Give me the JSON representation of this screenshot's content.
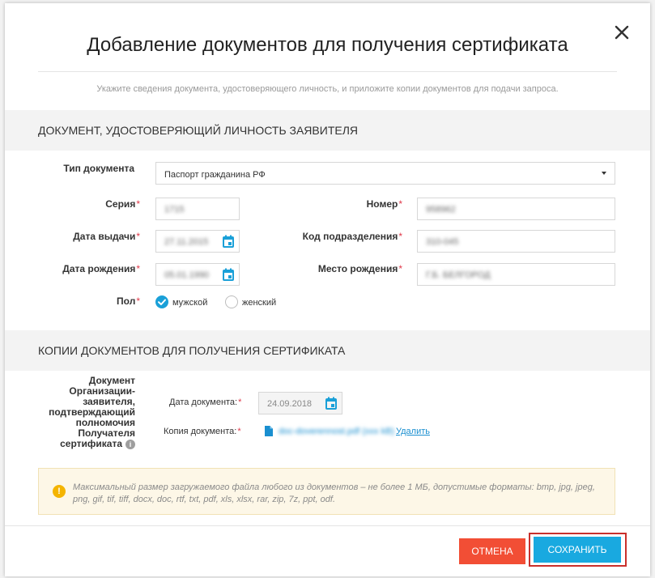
{
  "dialog": {
    "title": "Добавление документов для получения сертификата",
    "subtitle": "Укажите сведения документа, удостоверяющего личность, и приложите копии документов для подачи запроса."
  },
  "identity_section": {
    "heading": "ДОКУМЕНТ, УДОСТОВЕРЯЮЩИЙ ЛИЧНОСТЬ ЗАЯВИТЕЛЯ",
    "doc_type_label": "Тип документа",
    "doc_type_value": "Паспорт гражданина РФ",
    "series_label": "Серия",
    "series_value": "1715",
    "number_label": "Номер",
    "number_value": "958962",
    "issue_date_label": "Дата выдачи",
    "issue_date_value": "27.11.2015",
    "dept_code_label": "Код подразделения",
    "dept_code_value": "310-045",
    "birth_date_label": "Дата рождения",
    "birth_date_value": "05.01.1990",
    "birth_place_label": "Место рождения",
    "birth_place_value": "Г.Б. БЕЛГОРОД",
    "gender_label": "Пол",
    "gender_male": "мужской",
    "gender_female": "женский",
    "gender_selected": "мужской",
    "required_mark": "*"
  },
  "copies_section": {
    "heading": "КОПИИ ДОКУМЕНТОВ ДЛЯ ПОЛУЧЕНИЯ СЕРТИФИКАТА",
    "doc_label_1": "Документ",
    "doc_label_2": "Организации-",
    "doc_label_3": "заявителя,",
    "doc_label_4": "подтверждающий",
    "doc_label_5": "полномочия",
    "doc_label_6": "Получателя",
    "doc_label_7": "сертификата",
    "doc_date_label": "Дата документа:",
    "doc_date_value": "24.09.2018",
    "doc_copy_label": "Копия документа:",
    "doc_copy_file": "doc-doverennost.pdf (xxx kB)",
    "delete_link": "Удалить"
  },
  "notice": {
    "text": "Максимальный размер загружаемого файла любого из документов – не более 1 МБ, допустимые форматы: bmp, jpg, jpeg, png, gif, tif, tiff, docx, doc, rtf, txt, pdf, xls, xlsx, rar, zip, 7z, ppt, odf.",
    "icon": "!"
  },
  "footer": {
    "cancel_label": "ОТМЕНА",
    "save_label": "СОХРАНИТЬ"
  },
  "colors": {
    "accent": "#19a9e0",
    "cancel": "#f24e35",
    "required": "#e0394a",
    "highlight_frame": "#c9302c"
  }
}
